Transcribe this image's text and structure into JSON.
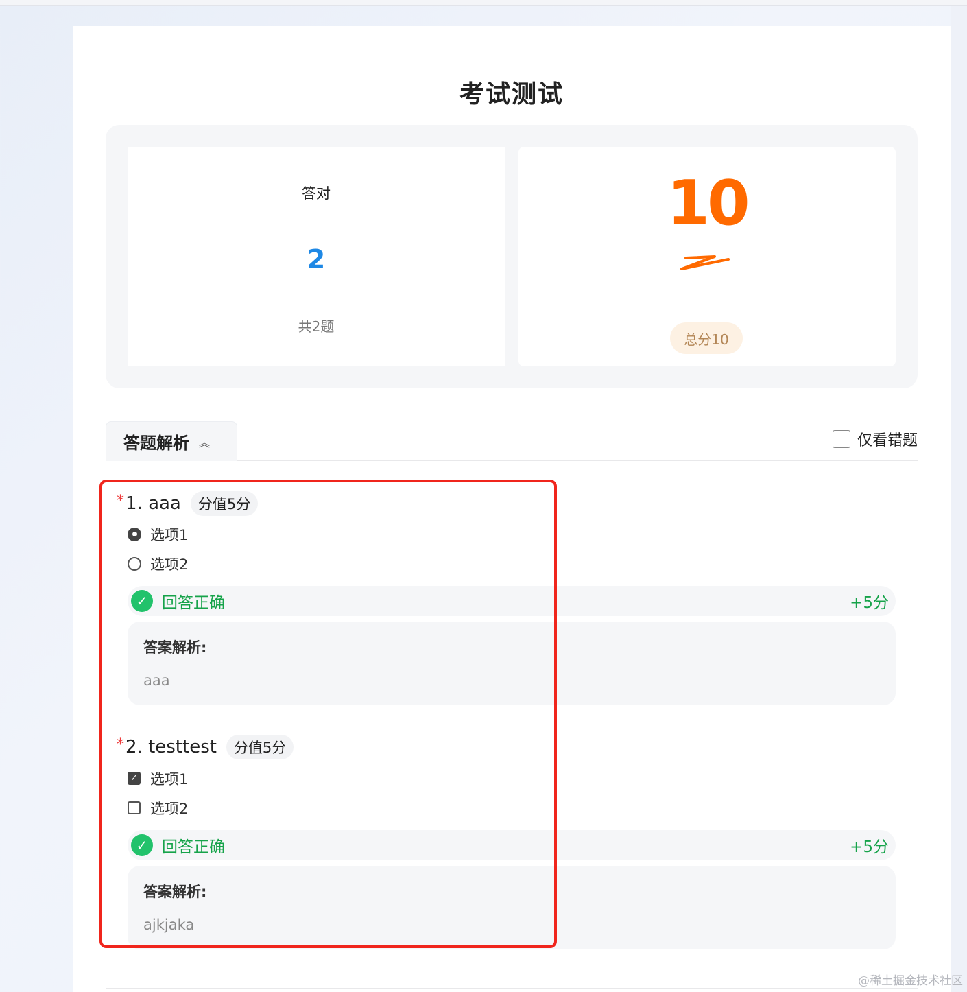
{
  "title": "考试测试",
  "summary": {
    "correct_label": "答对",
    "correct_count": "2",
    "total_questions": "共2题",
    "score": "10",
    "total_score": "总分10"
  },
  "tabs": {
    "analysis_tab": "答题解析",
    "wrong_only_label": "仅看错题"
  },
  "questions": [
    {
      "required": "*",
      "title": "1. aaa",
      "score": "分值5分",
      "type": "radio",
      "options": [
        {
          "label": "选项1",
          "selected": true
        },
        {
          "label": "选项2",
          "selected": false
        }
      ],
      "result": "回答正确",
      "points": "+5分",
      "analysis_label": "答案解析:",
      "analysis_text": "aaa"
    },
    {
      "required": "*",
      "title": "2. testtest",
      "score": "分值5分",
      "type": "checkbox",
      "options": [
        {
          "label": "选项1",
          "selected": true
        },
        {
          "label": "选项2",
          "selected": false
        }
      ],
      "result": "回答正确",
      "points": "+5分",
      "analysis_label": "答案解析:",
      "analysis_text": "ajkjaka"
    }
  ],
  "watermark": "@稀土掘金技术社区",
  "colors": {
    "accent_blue": "#1e88e5",
    "score_orange": "#ff6a00",
    "success_green": "#16a34a",
    "highlight_red": "#f0251c"
  }
}
